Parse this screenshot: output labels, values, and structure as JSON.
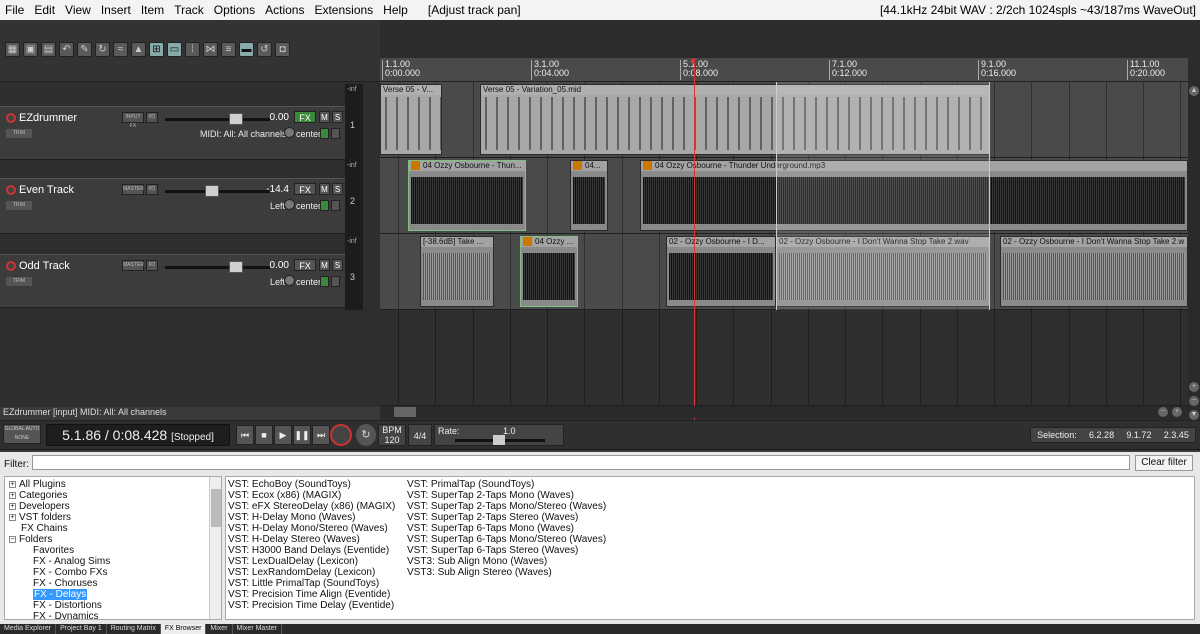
{
  "menu": {
    "items": [
      "File",
      "Edit",
      "View",
      "Insert",
      "Item",
      "Track",
      "Options",
      "Actions",
      "Extensions",
      "Help"
    ],
    "action_label": "[Adjust track pan]",
    "status": "[44.1kHz 24bit WAV : 2/2ch 1024spls ~43/187ms WaveOut]"
  },
  "toolbar": {
    "icons": [
      "grid-icon",
      "save-icon",
      "project-settings-icon",
      "undo-icon",
      "wrench-icon",
      "loop-icon",
      "ripple-icon",
      "snap-icon",
      "metronome-icon",
      "envelope-icon",
      "mixer-icon",
      "auto-crossfade-icon",
      "lock-icon",
      "marker-icon",
      "grid-lines-icon",
      "record-arm-icon",
      "lock-item-icon"
    ]
  },
  "tracks": [
    {
      "name": "EZdrummer",
      "volume": "0.00",
      "route": "INPUT FX",
      "io": "I/O",
      "fx": "FX",
      "mute": "M",
      "solo": "S",
      "trim": "TRIM",
      "sub": "MIDI: All: All channels",
      "pan": "center",
      "number": "1",
      "meter": "-inf"
    },
    {
      "name": "Even Track",
      "volume": "-14.4",
      "route": "MASTER",
      "io": "I/O",
      "fx": "FX",
      "mute": "M",
      "solo": "S",
      "trim": "TRIM",
      "sub": "Left",
      "pan": "center",
      "number": "2",
      "meter": "-inf"
    },
    {
      "name": "Odd Track",
      "volume": "0.00",
      "route": "MASTER",
      "io": "I/O",
      "fx": "FX",
      "mute": "M",
      "solo": "S",
      "trim": "TRIM",
      "sub": "Left",
      "pan": "center",
      "number": "3",
      "meter": "-inf"
    }
  ],
  "ruler": [
    {
      "bar": "1.1.00",
      "time": "0:00.000"
    },
    {
      "bar": "3.1.00",
      "time": "0:04.000"
    },
    {
      "bar": "5.1.00",
      "time": "0:08.000"
    },
    {
      "bar": "7.1.00",
      "time": "0:12.000"
    },
    {
      "bar": "9.1.00",
      "time": "0:16.000"
    },
    {
      "bar": "11.1.00",
      "time": "0:20.000"
    }
  ],
  "items": {
    "t1": [
      "Verse 05 - V...",
      "Verse 05 - Variation_05.mid"
    ],
    "t2": [
      "04 Ozzy Osbourne - Thun...",
      "04...",
      "04 Ozzy Osbourne - Thunder Underground.mp3"
    ],
    "t3": [
      "[-38.6dB] Take ...",
      "04 Ozzy ...",
      "02 - Ozzy Osbourne - I D...",
      "02 - Ozzy Osbourne - I Don't Wanna Stop Take 2.wav",
      "02 - Ozzy Osbourne - I Don't Wanna Stop Take 2.w"
    ]
  },
  "midi_info": "EZdrummer [input] MIDI: All: All channels",
  "transport": {
    "global_auto": "GLOBAL AUTO",
    "global_mode": "NONE",
    "position": "5.1.86 / 0:08.428",
    "state": "[Stopped]",
    "bpm_label": "BPM",
    "bpm": "120",
    "time_sig": "4/4",
    "rate_label": "Rate:",
    "rate": "1.0",
    "selection_label": "Selection:",
    "selection_start": "6.2.28",
    "selection_end": "9.1.72",
    "selection_length": "2.3.45"
  },
  "browser": {
    "filter_label": "Filter:",
    "filter_value": "",
    "clear_label": "Clear filter",
    "tree": [
      {
        "label": "All Plugins",
        "indent": 0,
        "exp": "+"
      },
      {
        "label": "Categories",
        "indent": 0,
        "exp": "+"
      },
      {
        "label": "Developers",
        "indent": 0,
        "exp": "+"
      },
      {
        "label": "VST folders",
        "indent": 0,
        "exp": "+"
      },
      {
        "label": "FX Chains",
        "indent": 1,
        "exp": ""
      },
      {
        "label": "Folders",
        "indent": 0,
        "exp": "-"
      },
      {
        "label": "Favorites",
        "indent": 2,
        "exp": ""
      },
      {
        "label": "FX - Analog Sims",
        "indent": 2,
        "exp": ""
      },
      {
        "label": "FX - Combo FXs",
        "indent": 2,
        "exp": ""
      },
      {
        "label": "FX - Choruses",
        "indent": 2,
        "exp": ""
      },
      {
        "label": "FX - Delays",
        "indent": 2,
        "exp": "",
        "selected": true
      },
      {
        "label": "FX - Distortions",
        "indent": 2,
        "exp": ""
      },
      {
        "label": "FX - Dynamics",
        "indent": 2,
        "exp": ""
      }
    ],
    "plugins_col1": [
      "VST: EchoBoy (SoundToys)",
      "VST: Ecox (x86) (MAGIX)",
      "VST: eFX StereoDelay (x86) (MAGIX)",
      "VST: H-Delay Mono (Waves)",
      "VST: H-Delay Mono/Stereo (Waves)",
      "VST: H-Delay Stereo (Waves)",
      "VST: H3000 Band Delays (Eventide)",
      "VST: LexDualDelay (Lexicon)",
      "VST: LexRandomDelay (Lexicon)",
      "VST: Little PrimalTap (SoundToys)",
      "VST: Precision Time Align (Eventide)",
      "VST: Precision Time Delay (Eventide)"
    ],
    "plugins_col2": [
      "VST: PrimalTap (SoundToys)",
      "VST: SuperTap 2-Taps Mono (Waves)",
      "VST: SuperTap 2-Taps Mono/Stereo (Waves)",
      "VST: SuperTap 2-Taps Stereo (Waves)",
      "VST: SuperTap 6-Taps Mono (Waves)",
      "VST: SuperTap 6-Taps Mono/Stereo (Waves)",
      "VST: SuperTap 6-Taps Stereo (Waves)",
      "VST3: Sub Align Mono (Waves)",
      "VST3: Sub Align Stereo (Waves)"
    ]
  },
  "tabs": [
    "Media Explorer",
    "Project Bay 1",
    "Routing Matrix",
    "FX Browser",
    "Mixer",
    "Mixer Master"
  ],
  "active_tab": "FX Browser",
  "colors": {
    "accent": "#3399ff",
    "record": "#cc3333",
    "fx_green": "#3b8a3b",
    "playcursor": "#dd3333"
  }
}
